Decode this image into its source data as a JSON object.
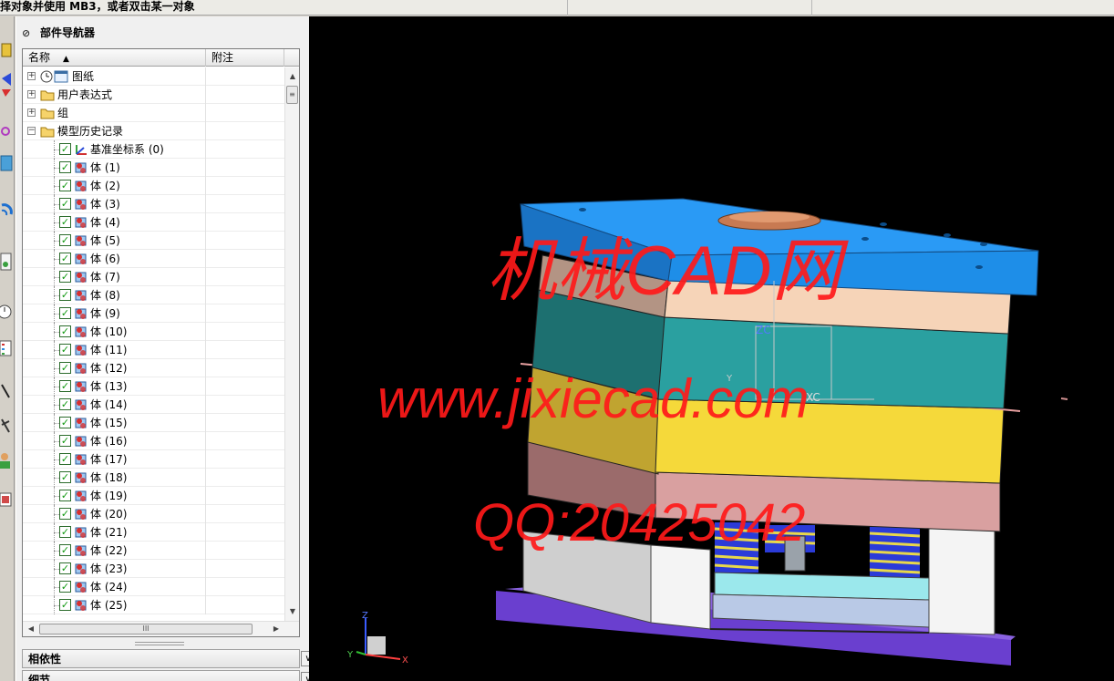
{
  "status_bar": {
    "text": "择对象并使用 MB3，或者双击某一对象"
  },
  "left_toolbar": {
    "icons": [
      "feature-icon",
      "direction-icon",
      "target-icon",
      "sheet-icon",
      "wifi-icon",
      "document-icon",
      "clock-icon",
      "list-icon",
      "pen-icon",
      "tool-icon",
      "user-icon",
      "image-icon"
    ]
  },
  "navigator": {
    "title": "部件导航器",
    "pin_icon": "pin-icon",
    "columns": {
      "name": "名称",
      "note": "附注"
    },
    "top_nodes": [
      {
        "label": "图纸",
        "expander": "+",
        "icon": "drawing-icon"
      },
      {
        "label": "用户表达式",
        "expander": "+",
        "icon": "folder-icon"
      },
      {
        "label": "组",
        "expander": "+",
        "icon": "folder-icon"
      },
      {
        "label": "模型历史记录",
        "expander": "−",
        "icon": "folder-open-icon"
      }
    ],
    "history_items": [
      {
        "label": "基准坐标系 (0)",
        "icon": "datum-csys-icon"
      },
      {
        "label": "体 (1)",
        "icon": "body-icon"
      },
      {
        "label": "体 (2)",
        "icon": "body-icon"
      },
      {
        "label": "体 (3)",
        "icon": "body-icon"
      },
      {
        "label": "体 (4)",
        "icon": "body-icon"
      },
      {
        "label": "体 (5)",
        "icon": "body-icon"
      },
      {
        "label": "体 (6)",
        "icon": "body-icon"
      },
      {
        "label": "体 (7)",
        "icon": "body-icon"
      },
      {
        "label": "体 (8)",
        "icon": "body-icon"
      },
      {
        "label": "体 (9)",
        "icon": "body-icon"
      },
      {
        "label": "体 (10)",
        "icon": "body-icon"
      },
      {
        "label": "体 (11)",
        "icon": "body-icon"
      },
      {
        "label": "体 (12)",
        "icon": "body-icon"
      },
      {
        "label": "体 (13)",
        "icon": "body-icon"
      },
      {
        "label": "体 (14)",
        "icon": "body-icon"
      },
      {
        "label": "体 (15)",
        "icon": "body-icon"
      },
      {
        "label": "体 (16)",
        "icon": "body-icon"
      },
      {
        "label": "体 (17)",
        "icon": "body-icon"
      },
      {
        "label": "体 (18)",
        "icon": "body-icon"
      },
      {
        "label": "体 (19)",
        "icon": "body-icon"
      },
      {
        "label": "体 (20)",
        "icon": "body-icon"
      },
      {
        "label": "体 (21)",
        "icon": "body-icon"
      },
      {
        "label": "体 (22)",
        "icon": "body-icon"
      },
      {
        "label": "体 (23)",
        "icon": "body-icon"
      },
      {
        "label": "体 (24)",
        "icon": "body-icon"
      },
      {
        "label": "体 (25)",
        "icon": "body-icon"
      }
    ],
    "scroll": {
      "up": "▲",
      "down": "▼",
      "left": "◀",
      "right": "▶",
      "grip_v": "≡",
      "grip_h": "III"
    }
  },
  "sections": [
    {
      "label": "相依性",
      "toggle": "∨"
    },
    {
      "label": "细节",
      "toggle": "∨"
    }
  ],
  "viewport": {
    "watermark_lines": [
      "机械CAD网",
      "www.jixiecad.com",
      "QQ:20425042"
    ],
    "watermark_color": "#ff1a1a",
    "wcs_labels": {
      "z": "ZC",
      "x": "XC",
      "y": "Y"
    },
    "triad_labels": {
      "z": "Z",
      "x": "X",
      "y": "Y"
    },
    "colors": {
      "top_plate": "#1e8ee8",
      "peach_plate": "#f6d4b8",
      "teal_plate": "#2aa0a0",
      "yellow_plate": "#f5d93a",
      "pink_plate": "#d9a0a0",
      "spacer_block": "#f2f2f2",
      "base_plate": "#6a3fcf",
      "spring": "#2b3bd8",
      "ejector_plate": "#9be8ec",
      "ejector_retainer": "#b9c9e6",
      "sprue_bushing": "#c87a52"
    }
  }
}
